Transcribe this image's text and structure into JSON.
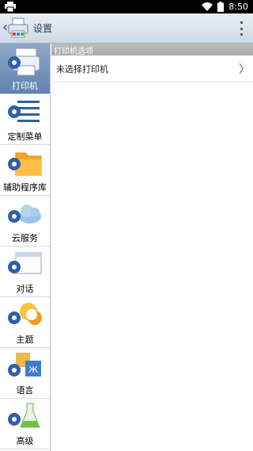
{
  "status_bar": {
    "time": "8:50",
    "left_icon": "printer-notification-icon",
    "wifi_icon": "wifi-icon",
    "battery_icon": "battery-icon"
  },
  "app_bar": {
    "title": "设置",
    "back_glyph": "‹",
    "app_icon": "printer-app-icon",
    "menu_icon": "overflow-menu-icon"
  },
  "sidebar": {
    "items": [
      {
        "label": "打印机",
        "icon": "printer-gear-icon",
        "active": true
      },
      {
        "label": "定制菜单",
        "icon": "menu-list-gear-icon",
        "active": false
      },
      {
        "label": "辅助程序库",
        "icon": "folder-gear-icon",
        "active": false
      },
      {
        "label": "云服务",
        "icon": "cloud-gear-icon",
        "active": false
      },
      {
        "label": "对话",
        "icon": "dialog-window-gear-icon",
        "active": false
      },
      {
        "label": "主题",
        "icon": "sun-moon-gear-icon",
        "active": false
      },
      {
        "label": "语言",
        "icon": "language-gear-icon",
        "active": false
      },
      {
        "label": "高级",
        "icon": "flask-gear-icon",
        "active": false
      }
    ]
  },
  "main": {
    "section_title": "打印机选项",
    "rows": [
      {
        "label": "未选择打印机",
        "chevron": "〉"
      }
    ]
  },
  "colors": {
    "active_item": "#6f8fb8",
    "gear": "#2f5fa8",
    "section_header": "#b3b3b3"
  }
}
